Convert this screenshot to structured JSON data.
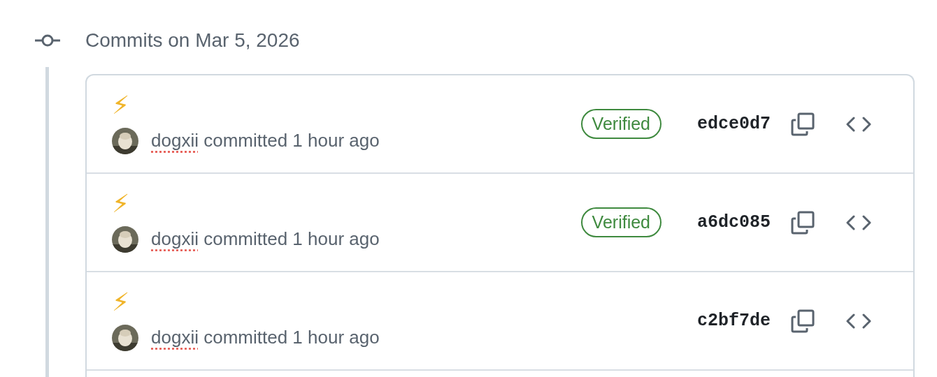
{
  "heading": "Commits on Mar 5, 2026",
  "commits": [
    {
      "message": "⚡",
      "author": "dogxii",
      "action": "committed",
      "time": "1 hour ago",
      "verified": true,
      "badge": "Verified",
      "sha": "edce0d7"
    },
    {
      "message": "⚡",
      "author": "dogxii",
      "action": "committed",
      "time": "1 hour ago",
      "verified": true,
      "badge": "Verified",
      "sha": "a6dc085"
    },
    {
      "message": "⚡",
      "author": "dogxii",
      "action": "committed",
      "time": "1 hour ago",
      "verified": false,
      "sha": "c2bf7de"
    }
  ]
}
